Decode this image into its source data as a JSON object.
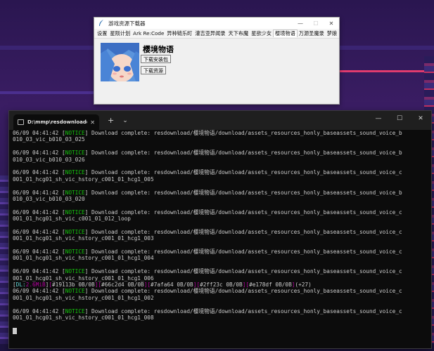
{
  "downloader": {
    "title": "游戏资源下载器",
    "menu": [
      "设置",
      "星陨计划",
      "Ark Re:Code",
      "异种链乐町",
      "灌吉亚异闻录",
      "天下布魔",
      "星欲少女",
      "樱境物语",
      "万源圣魔录",
      "梦娘"
    ],
    "active_menu_index": 7,
    "game_name": "樱境物语",
    "download_apk_label": "下载安装包",
    "download_res_label": "下载资源",
    "minimize": "—",
    "maximize": "☐",
    "close": "✕"
  },
  "terminal": {
    "tab_title": "D:\\mmp\\resdownloader\\resd",
    "tab_close": "✕",
    "new_tab": "+",
    "dropdown": "⌄",
    "minimize": "—",
    "maximize": "☐",
    "close": "✕",
    "lines": [
      {
        "ts": "06/09 04:41:42",
        "level": "NOTICE",
        "msg": "Download complete: resdownload/樱境物语/download/assets_resources_honly_baseassets_sound_voice_b"
      },
      {
        "cont": "010_03_vic_b010_03_025"
      },
      {
        "blank": true
      },
      {
        "ts": "06/09 04:41:42",
        "level": "NOTICE",
        "msg": "Download complete: resdownload/樱境物语/download/assets_resources_honly_baseassets_sound_voice_b"
      },
      {
        "cont": "010_03_vic_b010_03_026"
      },
      {
        "blank": true
      },
      {
        "ts": "06/09 04:41:42",
        "level": "NOTICE",
        "msg": "Download complete: resdownload/樱境物语/download/assets_resources_honly_baseassets_sound_voice_c"
      },
      {
        "cont": "001_01_hcg01_sh_vic_hstory_c001_01_hcg1_005"
      },
      {
        "blank": true
      },
      {
        "ts": "06/09 04:41:42",
        "level": "NOTICE",
        "msg": "Download complete: resdownload/樱境物语/download/assets_resources_honly_baseassets_sound_voice_b"
      },
      {
        "cont": "010_03_vic_b010_03_020"
      },
      {
        "blank": true
      },
      {
        "ts": "06/09 04:41:42",
        "level": "NOTICE",
        "msg": "Download complete: resdownload/樱境物语/download/assets_resources_honly_baseassets_sound_voice_c"
      },
      {
        "cont": "001_01_hcg01_sh_vic_c001_01_012_loop"
      },
      {
        "blank": true
      },
      {
        "ts": "06/09 04:41:42",
        "level": "NOTICE",
        "msg": "Download complete: resdownload/樱境物语/download/assets_resources_honly_baseassets_sound_voice_c"
      },
      {
        "cont": "001_01_hcg01_sh_vic_hstory_c001_01_hcg1_003"
      },
      {
        "blank": true
      },
      {
        "ts": "06/09 04:41:42",
        "level": "NOTICE",
        "msg": "Download complete: resdownload/樱境物语/download/assets_resources_honly_baseassets_sound_voice_c"
      },
      {
        "cont": "001_01_hcg01_sh_vic_hstory_c001_01_hcg1_004"
      },
      {
        "blank": true
      },
      {
        "ts": "06/09 04:41:42",
        "level": "NOTICE",
        "msg": "Download complete: resdownload/樱境物语/download/assets_resources_honly_baseassets_sound_voice_c"
      },
      {
        "cont": "001_01_hcg01_sh_vic_hstory_c001_01_hcg1_006"
      },
      {
        "progress": true
      },
      {
        "ts": "06/09 04:41:42",
        "level": "NOTICE",
        "msg": "Download complete: resdownload/樱境物语/download/assets_resources_honly_baseassets_sound_voice_c"
      },
      {
        "cont": "001_01_hcg01_sh_vic_hstory_c001_01_hcg1_002"
      },
      {
        "blank": true
      },
      {
        "ts": "06/09 04:41:42",
        "level": "NOTICE",
        "msg": "Download complete: resdownload/樱境物语/download/assets_resources_honly_baseassets_sound_voice_c"
      },
      {
        "cont": "001_01_hcg01_sh_vic_hstory_c001_01_hcg1_008"
      },
      {
        "blank": true
      },
      {
        "cursor": true
      }
    ],
    "progress": {
      "dl_label": "DL:",
      "dl_value": "2.6MiB",
      "items": [
        "#19113b 0B/0B",
        "#66c2d4 0B/0B",
        "#7afa64 0B/0B",
        "#2ff23c 0B/0B",
        "#e178df 0B/0B"
      ],
      "extra": "(+27)"
    }
  },
  "colors": {
    "notice": "#16c60c",
    "dl": "#61d6d6",
    "dl_value": "#b4009e",
    "terminal_bg": "#0c0c0c",
    "desktop_bg": "#2a1650"
  }
}
